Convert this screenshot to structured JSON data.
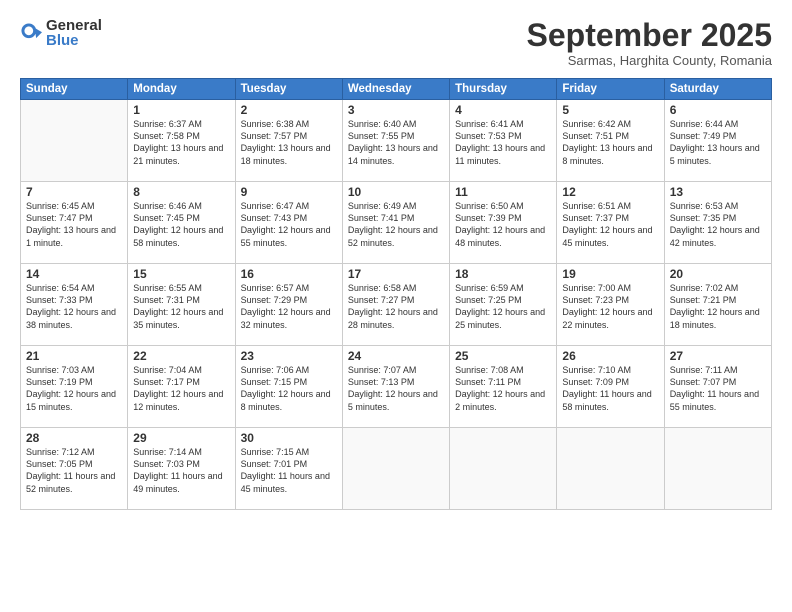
{
  "logo": {
    "general": "General",
    "blue": "Blue"
  },
  "title": "September 2025",
  "subtitle": "Sarmas, Harghita County, Romania",
  "headers": [
    "Sunday",
    "Monday",
    "Tuesday",
    "Wednesday",
    "Thursday",
    "Friday",
    "Saturday"
  ],
  "weeks": [
    [
      {
        "day": "",
        "info": ""
      },
      {
        "day": "1",
        "info": "Sunrise: 6:37 AM\nSunset: 7:58 PM\nDaylight: 13 hours\nand 21 minutes."
      },
      {
        "day": "2",
        "info": "Sunrise: 6:38 AM\nSunset: 7:57 PM\nDaylight: 13 hours\nand 18 minutes."
      },
      {
        "day": "3",
        "info": "Sunrise: 6:40 AM\nSunset: 7:55 PM\nDaylight: 13 hours\nand 14 minutes."
      },
      {
        "day": "4",
        "info": "Sunrise: 6:41 AM\nSunset: 7:53 PM\nDaylight: 13 hours\nand 11 minutes."
      },
      {
        "day": "5",
        "info": "Sunrise: 6:42 AM\nSunset: 7:51 PM\nDaylight: 13 hours\nand 8 minutes."
      },
      {
        "day": "6",
        "info": "Sunrise: 6:44 AM\nSunset: 7:49 PM\nDaylight: 13 hours\nand 5 minutes."
      }
    ],
    [
      {
        "day": "7",
        "info": "Sunrise: 6:45 AM\nSunset: 7:47 PM\nDaylight: 13 hours\nand 1 minute."
      },
      {
        "day": "8",
        "info": "Sunrise: 6:46 AM\nSunset: 7:45 PM\nDaylight: 12 hours\nand 58 minutes."
      },
      {
        "day": "9",
        "info": "Sunrise: 6:47 AM\nSunset: 7:43 PM\nDaylight: 12 hours\nand 55 minutes."
      },
      {
        "day": "10",
        "info": "Sunrise: 6:49 AM\nSunset: 7:41 PM\nDaylight: 12 hours\nand 52 minutes."
      },
      {
        "day": "11",
        "info": "Sunrise: 6:50 AM\nSunset: 7:39 PM\nDaylight: 12 hours\nand 48 minutes."
      },
      {
        "day": "12",
        "info": "Sunrise: 6:51 AM\nSunset: 7:37 PM\nDaylight: 12 hours\nand 45 minutes."
      },
      {
        "day": "13",
        "info": "Sunrise: 6:53 AM\nSunset: 7:35 PM\nDaylight: 12 hours\nand 42 minutes."
      }
    ],
    [
      {
        "day": "14",
        "info": "Sunrise: 6:54 AM\nSunset: 7:33 PM\nDaylight: 12 hours\nand 38 minutes."
      },
      {
        "day": "15",
        "info": "Sunrise: 6:55 AM\nSunset: 7:31 PM\nDaylight: 12 hours\nand 35 minutes."
      },
      {
        "day": "16",
        "info": "Sunrise: 6:57 AM\nSunset: 7:29 PM\nDaylight: 12 hours\nand 32 minutes."
      },
      {
        "day": "17",
        "info": "Sunrise: 6:58 AM\nSunset: 7:27 PM\nDaylight: 12 hours\nand 28 minutes."
      },
      {
        "day": "18",
        "info": "Sunrise: 6:59 AM\nSunset: 7:25 PM\nDaylight: 12 hours\nand 25 minutes."
      },
      {
        "day": "19",
        "info": "Sunrise: 7:00 AM\nSunset: 7:23 PM\nDaylight: 12 hours\nand 22 minutes."
      },
      {
        "day": "20",
        "info": "Sunrise: 7:02 AM\nSunset: 7:21 PM\nDaylight: 12 hours\nand 18 minutes."
      }
    ],
    [
      {
        "day": "21",
        "info": "Sunrise: 7:03 AM\nSunset: 7:19 PM\nDaylight: 12 hours\nand 15 minutes."
      },
      {
        "day": "22",
        "info": "Sunrise: 7:04 AM\nSunset: 7:17 PM\nDaylight: 12 hours\nand 12 minutes."
      },
      {
        "day": "23",
        "info": "Sunrise: 7:06 AM\nSunset: 7:15 PM\nDaylight: 12 hours\nand 8 minutes."
      },
      {
        "day": "24",
        "info": "Sunrise: 7:07 AM\nSunset: 7:13 PM\nDaylight: 12 hours\nand 5 minutes."
      },
      {
        "day": "25",
        "info": "Sunrise: 7:08 AM\nSunset: 7:11 PM\nDaylight: 12 hours\nand 2 minutes."
      },
      {
        "day": "26",
        "info": "Sunrise: 7:10 AM\nSunset: 7:09 PM\nDaylight: 11 hours\nand 58 minutes."
      },
      {
        "day": "27",
        "info": "Sunrise: 7:11 AM\nSunset: 7:07 PM\nDaylight: 11 hours\nand 55 minutes."
      }
    ],
    [
      {
        "day": "28",
        "info": "Sunrise: 7:12 AM\nSunset: 7:05 PM\nDaylight: 11 hours\nand 52 minutes."
      },
      {
        "day": "29",
        "info": "Sunrise: 7:14 AM\nSunset: 7:03 PM\nDaylight: 11 hours\nand 49 minutes."
      },
      {
        "day": "30",
        "info": "Sunrise: 7:15 AM\nSunset: 7:01 PM\nDaylight: 11 hours\nand 45 minutes."
      },
      {
        "day": "",
        "info": ""
      },
      {
        "day": "",
        "info": ""
      },
      {
        "day": "",
        "info": ""
      },
      {
        "day": "",
        "info": ""
      }
    ]
  ]
}
